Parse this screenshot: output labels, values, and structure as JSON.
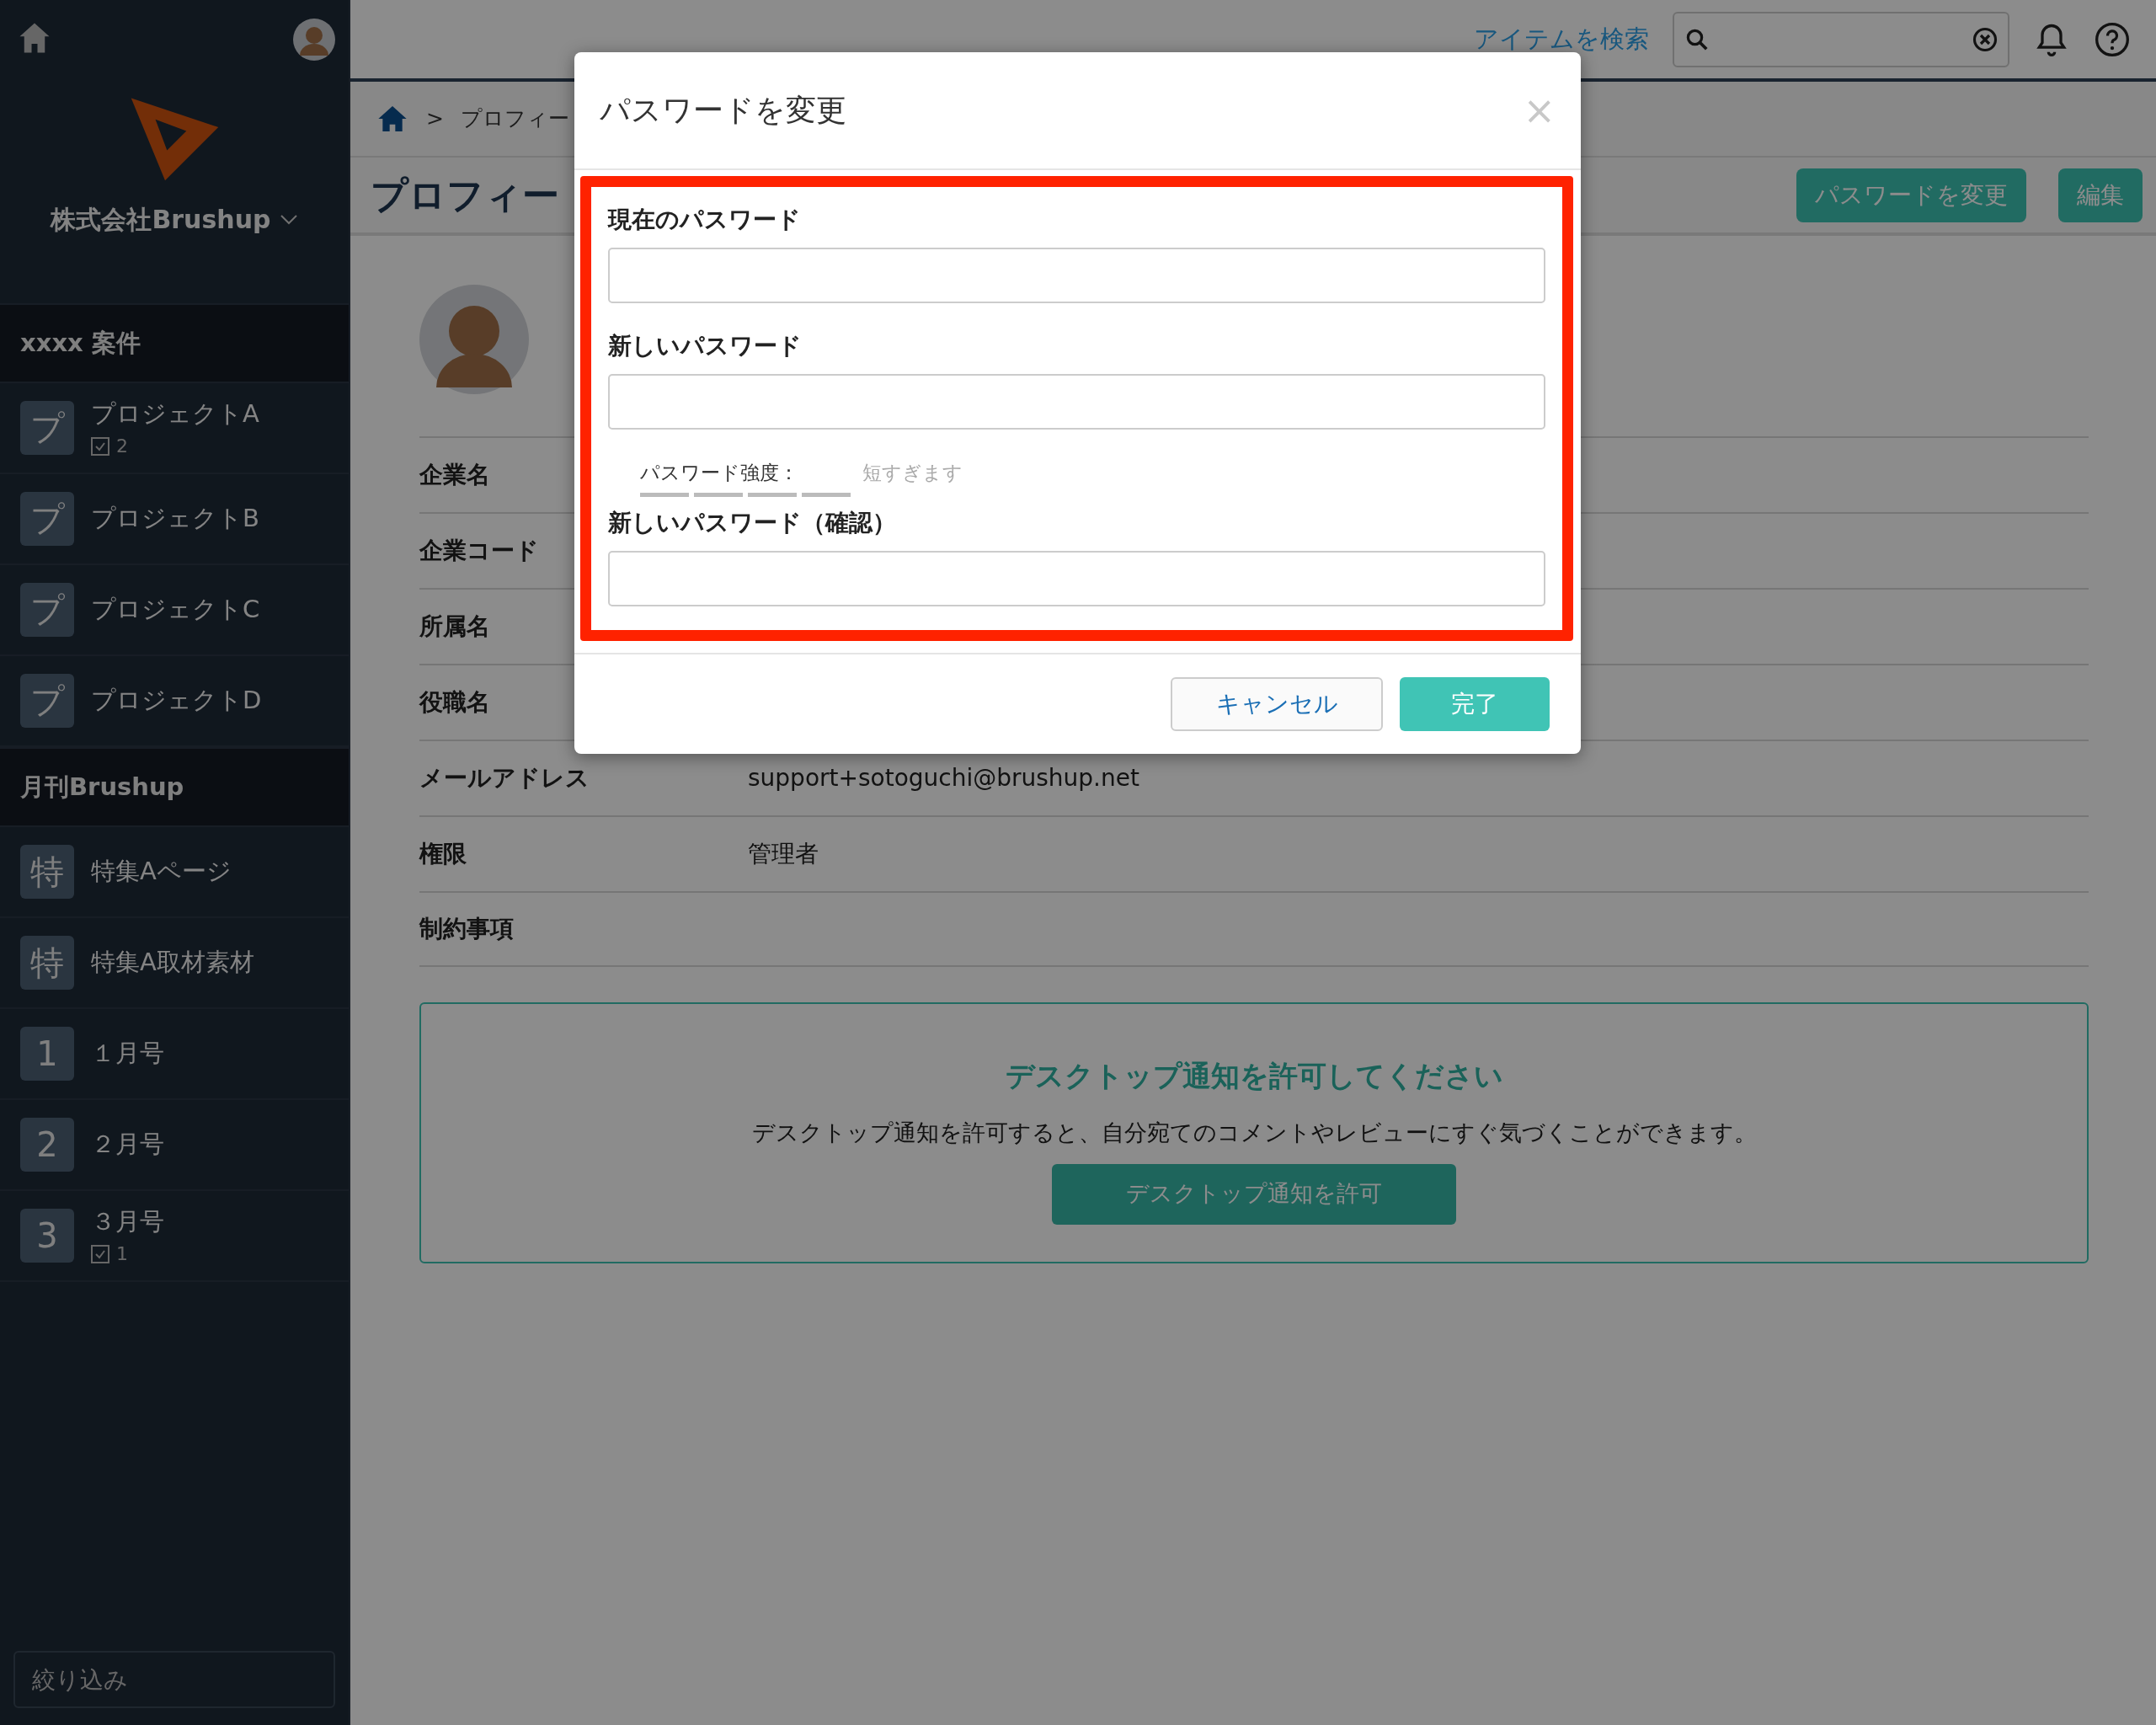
{
  "sidebar": {
    "company": "株式会社Brushup",
    "groups": [
      {
        "title": "xxxx 案件",
        "items": [
          {
            "badge": "プ",
            "label": "プロジェクトA",
            "tasks": "2"
          },
          {
            "badge": "プ",
            "label": "プロジェクトB"
          },
          {
            "badge": "プ",
            "label": "プロジェクトC"
          },
          {
            "badge": "プ",
            "label": "プロジェクトD"
          }
        ]
      },
      {
        "title": "月刊Brushup",
        "items": [
          {
            "badge": "特",
            "label": "特集Aページ"
          },
          {
            "badge": "特",
            "label": "特集A取材素材"
          },
          {
            "badge": "1",
            "label": "１月号"
          },
          {
            "badge": "2",
            "label": "２月号"
          },
          {
            "badge": "3",
            "label": "３月号",
            "tasks": "1"
          }
        ]
      }
    ],
    "filter": {
      "placeholder": "絞り込み"
    }
  },
  "topbar": {
    "search_link": "アイテムを検索"
  },
  "breadcrumb": [
    {
      "separator": ">",
      "label": "プロフィー"
    }
  ],
  "page_title": "プロフィー",
  "header_buttons": [
    "パスワードを変更",
    "編集"
  ],
  "profile": {
    "rows": [
      {
        "label": "企業名"
      },
      {
        "label": "企業コード"
      },
      {
        "label": "所属名"
      },
      {
        "label": "役職名"
      },
      {
        "label": "メールアドレス",
        "value": "support+sotoguchi@brushup.net"
      },
      {
        "label": "権限",
        "value": "管理者"
      },
      {
        "label": "制約事項"
      }
    ]
  },
  "notification": {
    "title": "デスクトップ通知を許可してください",
    "text": "デスクトップ通知を許可すると、自分宛てのコメントやレビューにすぐ気づくことができます。",
    "button": "デスクトップ通知を許可"
  },
  "modal": {
    "title": "パスワードを変更",
    "close": "×",
    "items": [
      {
        "kind": "field",
        "label": "現在のパスワード"
      },
      {
        "kind": "field",
        "label": "新しいパスワード"
      },
      {
        "kind": "strength",
        "label": "パスワード強度：",
        "level": 0,
        "reading": "短すぎます"
      },
      {
        "kind": "field",
        "label": "新しいパスワード（確認）"
      }
    ],
    "buttons": [
      {
        "kind": "secondary",
        "label": "キャンセル"
      },
      {
        "kind": "primary",
        "label": "完了"
      }
    ]
  }
}
